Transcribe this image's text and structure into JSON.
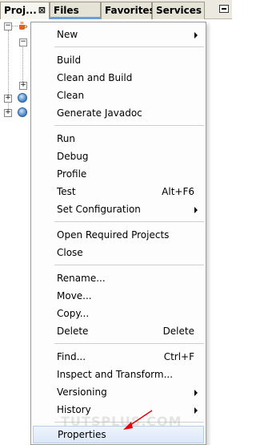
{
  "tabs": [
    {
      "label": "Proj...",
      "close": "⊠"
    },
    {
      "label": "Files"
    },
    {
      "label": "Favorites"
    },
    {
      "label": "Services"
    }
  ],
  "menu": {
    "new": "New",
    "build": "Build",
    "clean_build": "Clean and Build",
    "clean": "Clean",
    "javadoc": "Generate Javadoc",
    "run": "Run",
    "debug": "Debug",
    "profile": "Profile",
    "test": "Test",
    "test_accel": "Alt+F6",
    "set_config": "Set Configuration",
    "open_required": "Open Required Projects",
    "close": "Close",
    "rename": "Rename...",
    "move": "Move...",
    "copy": "Copy...",
    "delete": "Delete",
    "delete_accel": "Delete",
    "find": "Find...",
    "find_accel": "Ctrl+F",
    "inspect": "Inspect and Transform...",
    "versioning": "Versioning",
    "history": "History",
    "properties": "Properties"
  },
  "tree": {
    "collapse": "−",
    "expand": "+"
  },
  "watermark": "TUTSPLUS.COM",
  "colors": {
    "accent_arrow": "#e8000a",
    "highlight": "#dce8f8"
  }
}
